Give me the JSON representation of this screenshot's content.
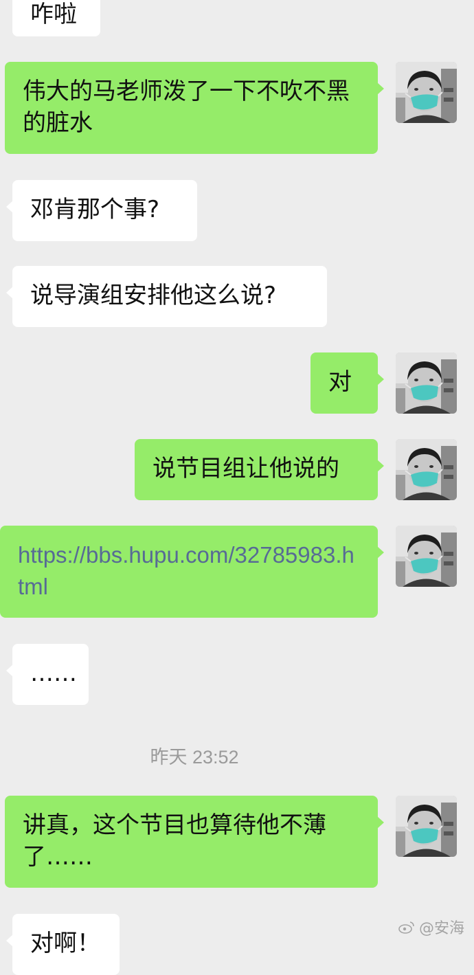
{
  "messages": {
    "m1": "咋啦",
    "m2": "伟大的马老师泼了一下不吹不黑的脏水",
    "m3": "邓肯那个事?",
    "m4": "说导演组安排他这么说?",
    "m5": "对",
    "m6": "说节目组让他说的",
    "m7": "https://bbs.hupu.com/32785983.html",
    "m8": "……",
    "m9": "讲真，这个节目也算待他不薄了……",
    "m10": "对啊！"
  },
  "timestamp": "昨天 23:52",
  "watermark": "@安海",
  "colors": {
    "background": "#ededed",
    "sent_bubble": "#95ec69",
    "received_bubble": "#ffffff",
    "link": "#576b95",
    "mask": "#4cc7c0"
  },
  "icons": {
    "avatar": "masked-person-avatar-icon",
    "watermark": "weibo-logo-icon"
  }
}
